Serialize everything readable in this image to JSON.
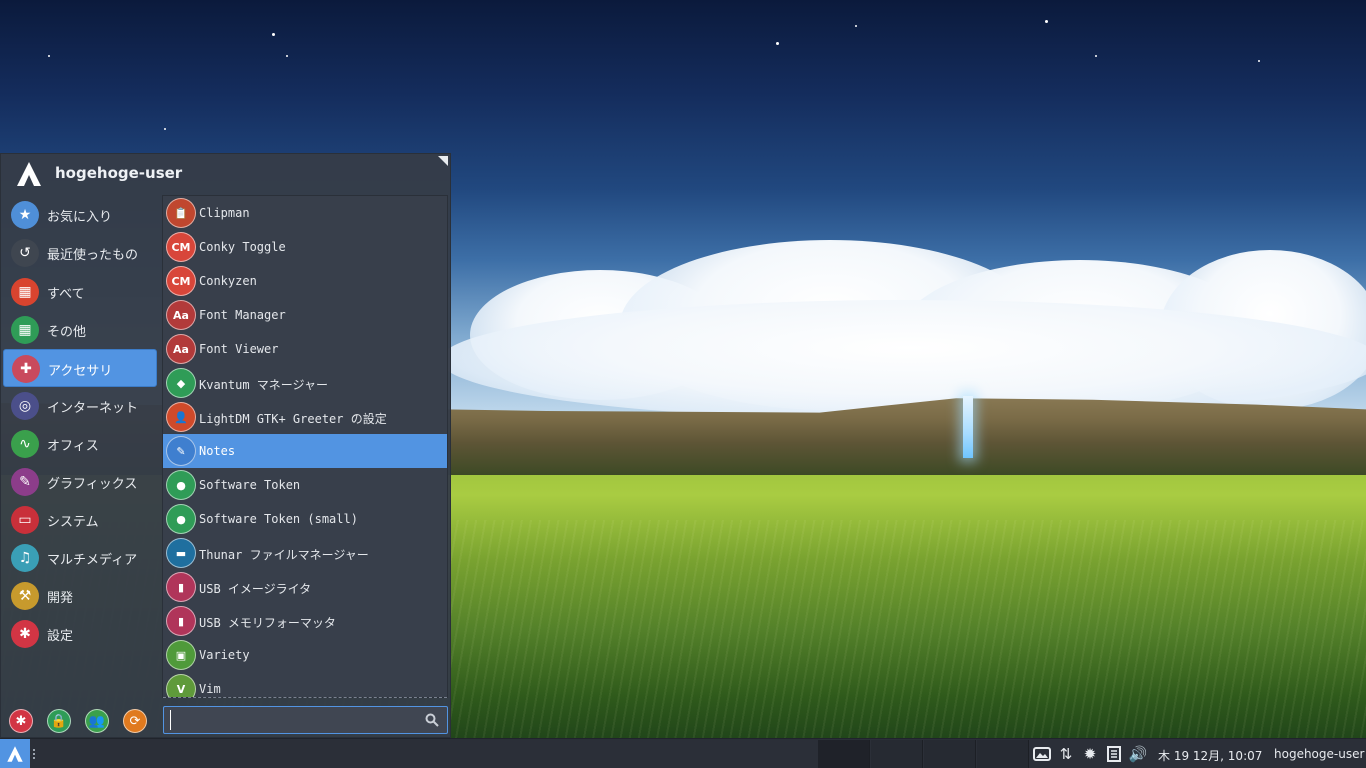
{
  "menu": {
    "username": "hogehoge-user",
    "categories": [
      {
        "label": "お気に入り",
        "icon": "star-folder-icon",
        "color": "#4f8fd8"
      },
      {
        "label": "最近使ったもの",
        "icon": "recent-history-icon",
        "color": "#3f4650"
      },
      {
        "label": "すべて",
        "icon": "all-apps-icon",
        "color": "#d9442f"
      },
      {
        "label": "その他",
        "icon": "other-apps-icon",
        "color": "#2f9c57"
      },
      {
        "label": "アクセサリ",
        "icon": "accessories-icon",
        "color": "#c94a5d"
      },
      {
        "label": "インターネット",
        "icon": "internet-globe-icon",
        "color": "#4b4f8a"
      },
      {
        "label": "オフィス",
        "icon": "office-chart-icon",
        "color": "#3aa04c"
      },
      {
        "label": "グラフィックス",
        "icon": "graphics-palette-icon",
        "color": "#8c3d8a"
      },
      {
        "label": "システム",
        "icon": "system-icon",
        "color": "#c9303a"
      },
      {
        "label": "マルチメディア",
        "icon": "multimedia-icon",
        "color": "#3a9fb6"
      },
      {
        "label": "開発",
        "icon": "development-icon",
        "color": "#c79a2d"
      },
      {
        "label": "設定",
        "icon": "settings-gear-icon",
        "color": "#d23544"
      }
    ],
    "active_category": "アクセサリ",
    "apps": [
      {
        "label": "Clipman",
        "icon": "clipman-icon",
        "glyph": "📋",
        "color": "#c0472f"
      },
      {
        "label": "Conky Toggle",
        "icon": "conky-toggle-icon",
        "glyph": "CM",
        "color": "#d8463a"
      },
      {
        "label": "Conkyzen",
        "icon": "conkyzen-icon",
        "glyph": "CM",
        "color": "#d8463a"
      },
      {
        "label": "Font Manager",
        "icon": "font-manager-icon",
        "glyph": "Aa",
        "color": "#b23a3a"
      },
      {
        "label": "Font Viewer",
        "icon": "font-viewer-icon",
        "glyph": "Aa",
        "color": "#b23a3a"
      },
      {
        "label": "Kvantum マネージャー",
        "icon": "kvantum-icon",
        "glyph": "◆",
        "color": "#2f9c57"
      },
      {
        "label": "LightDM GTK+ Greeter の設定",
        "icon": "lightdm-icon",
        "glyph": "👤",
        "color": "#d04a2a"
      },
      {
        "label": "Notes",
        "icon": "notes-icon",
        "glyph": "✎",
        "color": "#3f7fcf"
      },
      {
        "label": "Software Token",
        "icon": "software-token-icon",
        "glyph": "●",
        "color": "#2f9c57"
      },
      {
        "label": "Software Token (small)",
        "icon": "software-token-small-icon",
        "glyph": "●",
        "color": "#2f9c57"
      },
      {
        "label": "Thunar ファイルマネージャー",
        "icon": "thunar-folder-icon",
        "glyph": "▬",
        "color": "#1f6f9f"
      },
      {
        "label": "USB イメージライタ",
        "icon": "usb-image-writer-icon",
        "glyph": "▮",
        "color": "#b0355a"
      },
      {
        "label": "USB メモリフォーマッタ",
        "icon": "usb-formatter-icon",
        "glyph": "▮",
        "color": "#b0355a"
      },
      {
        "label": "Variety",
        "icon": "variety-icon",
        "glyph": "▣",
        "color": "#4f9a3a"
      },
      {
        "label": "Vim",
        "icon": "vim-icon",
        "glyph": "V",
        "color": "#5f9a3a"
      }
    ],
    "active_app": "Notes",
    "bottom_actions": [
      {
        "name": "settings-action-icon",
        "glyph": "✱",
        "color": "#d23544"
      },
      {
        "name": "lock-screen-icon",
        "glyph": "🔒",
        "color": "#2f9c57"
      },
      {
        "name": "switch-user-icon",
        "glyph": "👥",
        "color": "#3aa04c"
      },
      {
        "name": "logout-icon",
        "glyph": "⟳",
        "color": "#e07a1f"
      }
    ],
    "search": {
      "value": "",
      "placeholder": ""
    }
  },
  "taskbar": {
    "clock": "木 19 12月, 10:07",
    "user": "hogehoge-user",
    "tray_icons": [
      "image-viewer-icon",
      "network-updown-icon",
      "settings-cog-icon",
      "notes-tray-icon",
      "volume-icon"
    ],
    "accent_color": "#5294e2"
  }
}
